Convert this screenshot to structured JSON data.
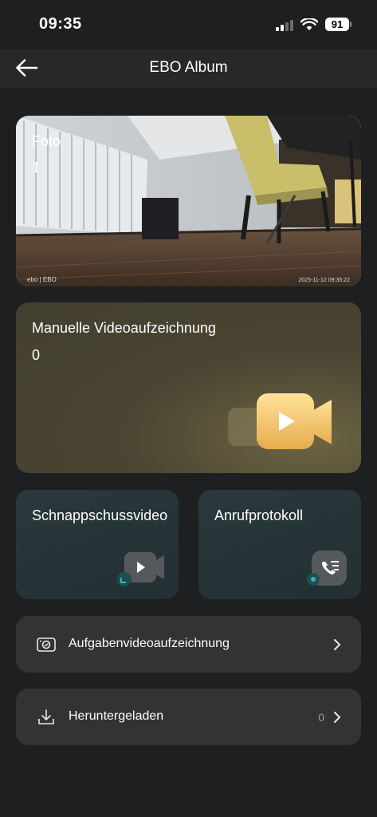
{
  "status_bar": {
    "time": "09:35",
    "battery": "91"
  },
  "nav": {
    "title": "EBO Album",
    "back_icon": "arrow-left-icon"
  },
  "cards": {
    "photo": {
      "label": "Foto",
      "count": "1",
      "watermark_brand": "ebo | EBO",
      "watermark_timestamp": "2025-11-12 09:35:22"
    },
    "manual_video": {
      "label": "Manuelle Videoaufzeichnung",
      "count": "0",
      "icon": "video-camera-icon",
      "accent": "#f0c46a"
    },
    "snapshot_video": {
      "label": "Schnappschussvideo",
      "icon": "video-camera-icon"
    },
    "call_log": {
      "label": "Anrufprotokoll",
      "icon": "phone-list-icon"
    }
  },
  "rows": {
    "task_video": {
      "label": "Aufgabenvideoaufzeichnung",
      "icon": "camera-task-icon"
    },
    "downloaded": {
      "label": "Heruntergeladen",
      "count": "0",
      "icon": "download-icon"
    }
  },
  "colors": {
    "background": "#1e1f21",
    "row_background": "#323335",
    "teal_accent": "#2aa3a8"
  }
}
